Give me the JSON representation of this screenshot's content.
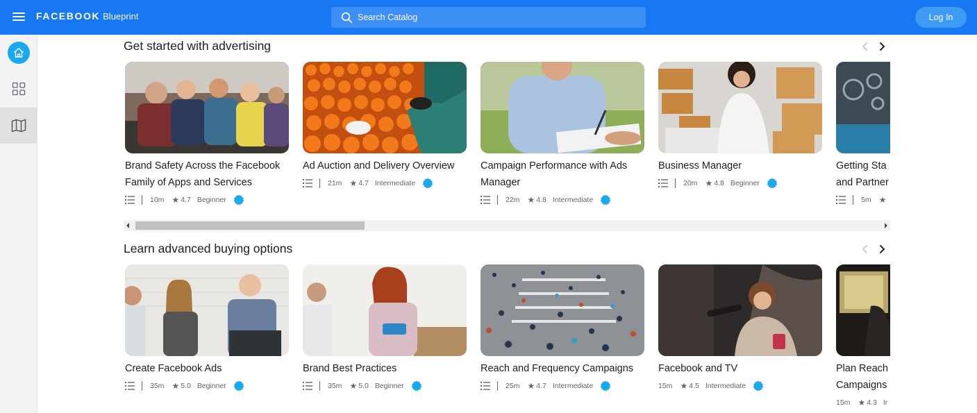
{
  "header": {
    "brand": "FACEBOOK",
    "product": "Blueprint",
    "search_placeholder": "Search Catalog",
    "login_label": "Log In",
    "bar_color": "#1877f2"
  },
  "rail": {
    "items": [
      {
        "icon": "home-icon",
        "active": true
      },
      {
        "icon": "grid-icon"
      },
      {
        "icon": "map-icon"
      }
    ]
  },
  "sections": [
    {
      "title": "Get started with advertising",
      "cards": [
        {
          "title": "Brand Safety Across the Facebook Family of Apps and Services",
          "duration": "10m",
          "rating": "4.7",
          "level": "Beginner"
        },
        {
          "title": "Ad Auction and Delivery Overview",
          "duration": "21m",
          "rating": "4.7",
          "level": "Intermediate"
        },
        {
          "title": "Campaign Performance with Ads Manager",
          "duration": "22m",
          "rating": "4.8",
          "level": "Intermediate"
        },
        {
          "title": "Business Manager",
          "duration": "20m",
          "rating": "4.8",
          "level": "Beginner"
        },
        {
          "title": "Getting Sta and Partner",
          "duration": "5m",
          "rating": "",
          "level": ""
        }
      ]
    },
    {
      "title": "Learn advanced buying options",
      "cards": [
        {
          "title": "Create Facebook Ads",
          "duration": "35m",
          "rating": "5.0",
          "level": "Beginner"
        },
        {
          "title": "Brand Best Practices",
          "duration": "35m",
          "rating": "5.0",
          "level": "Beginner"
        },
        {
          "title": "Reach and Frequency Campaigns",
          "duration": "25m",
          "rating": "4.7",
          "level": "Intermediate"
        },
        {
          "title": "Facebook and TV",
          "duration": "15m",
          "rating": "4.5",
          "level": "Intermediate"
        },
        {
          "title": "Plan Reach Campaigns",
          "duration": "15m",
          "rating": "4.3",
          "level": "Ir"
        }
      ]
    }
  ],
  "colors": {
    "accent": "#1877f2",
    "badge": "#1aa8ee",
    "muted_text": "#606770"
  }
}
